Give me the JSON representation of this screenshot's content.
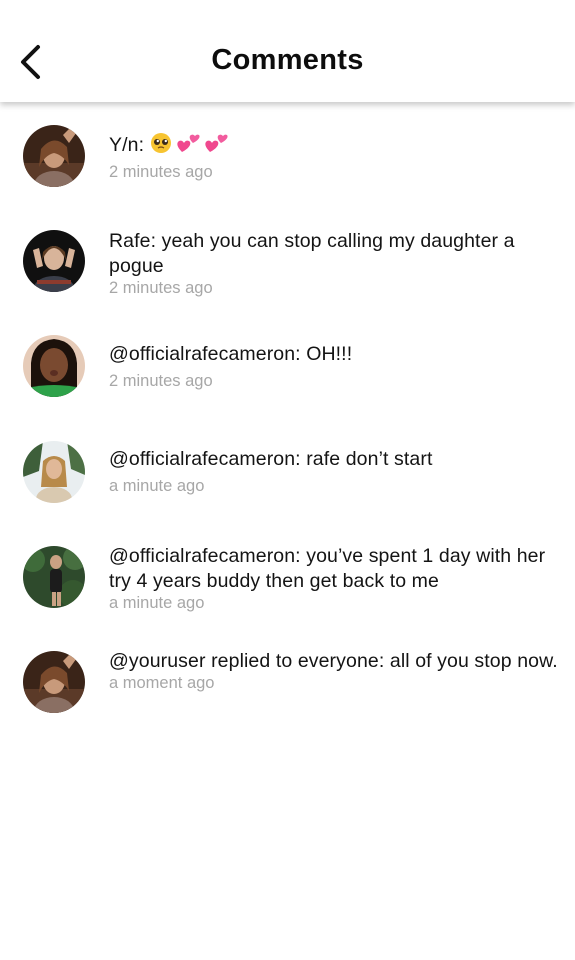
{
  "header": {
    "title": "Comments",
    "back_icon": "chevron-left-icon"
  },
  "comments": [
    {
      "prefix": "Y/n:",
      "emojis": [
        "pleading-face-icon",
        "two-hearts-icon",
        "two-hearts-icon"
      ],
      "time": "2 minutes ago"
    },
    {
      "text": "Rafe: yeah you can stop calling my daughter a pogue",
      "time": "2 minutes ago"
    },
    {
      "text": "@officialrafecameron: OH!!!",
      "time": "2 minutes ago"
    },
    {
      "text": "@officialrafecameron: rafe don’t start",
      "time": "a minute ago"
    },
    {
      "text": "@officialrafecameron: you’ve spent 1 day with her try 4 years buddy then get back to me",
      "time": "a minute ago"
    },
    {
      "text": "@youruser replied to everyone: all of you stop now.",
      "time": "a moment ago"
    }
  ],
  "colors": {
    "text": "#141414",
    "timestamp": "#a7a7a7",
    "background": "#ffffff"
  }
}
